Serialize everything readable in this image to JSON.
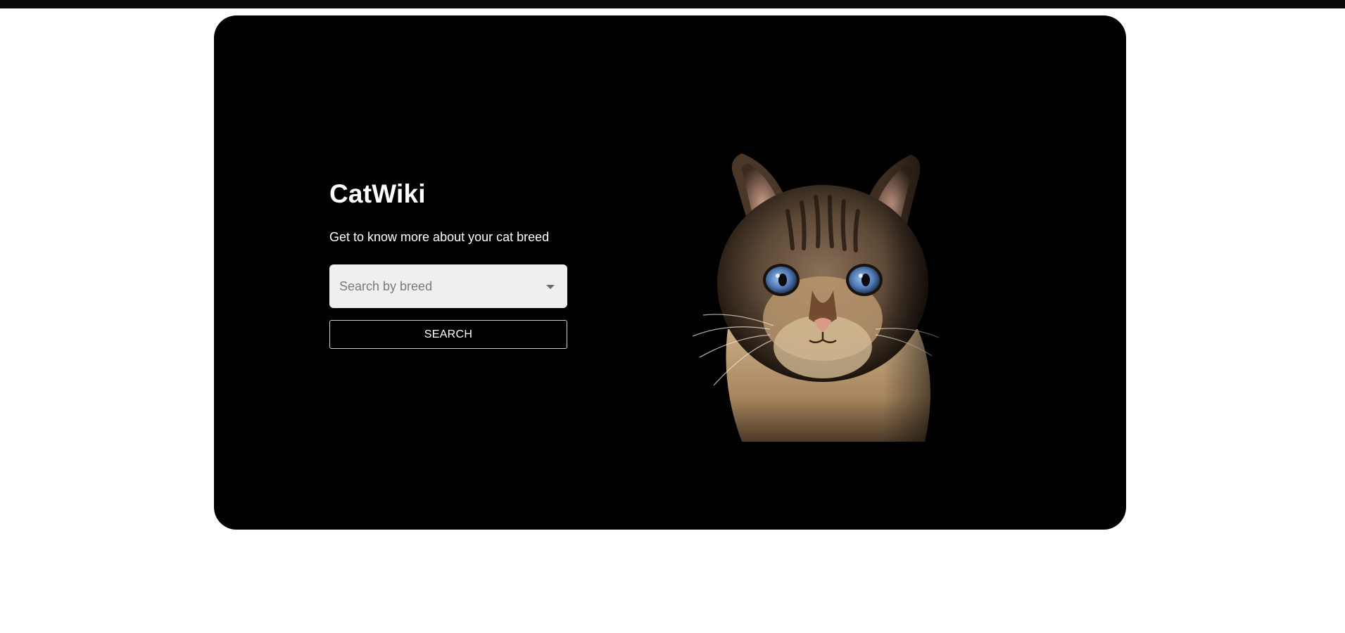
{
  "hero": {
    "title": "CatWiki",
    "tagline": "Get to know more about your cat breed",
    "search": {
      "placeholder": "Search by breed",
      "selected": ""
    },
    "search_button_label": "SEARCH",
    "image_icon": "cat-photo"
  },
  "colors": {
    "hero_background": "#000000",
    "page_background": "#ffffff",
    "select_background": "#efefef",
    "text_primary": "#ffffff",
    "placeholder_text": "#7a7a7a"
  }
}
